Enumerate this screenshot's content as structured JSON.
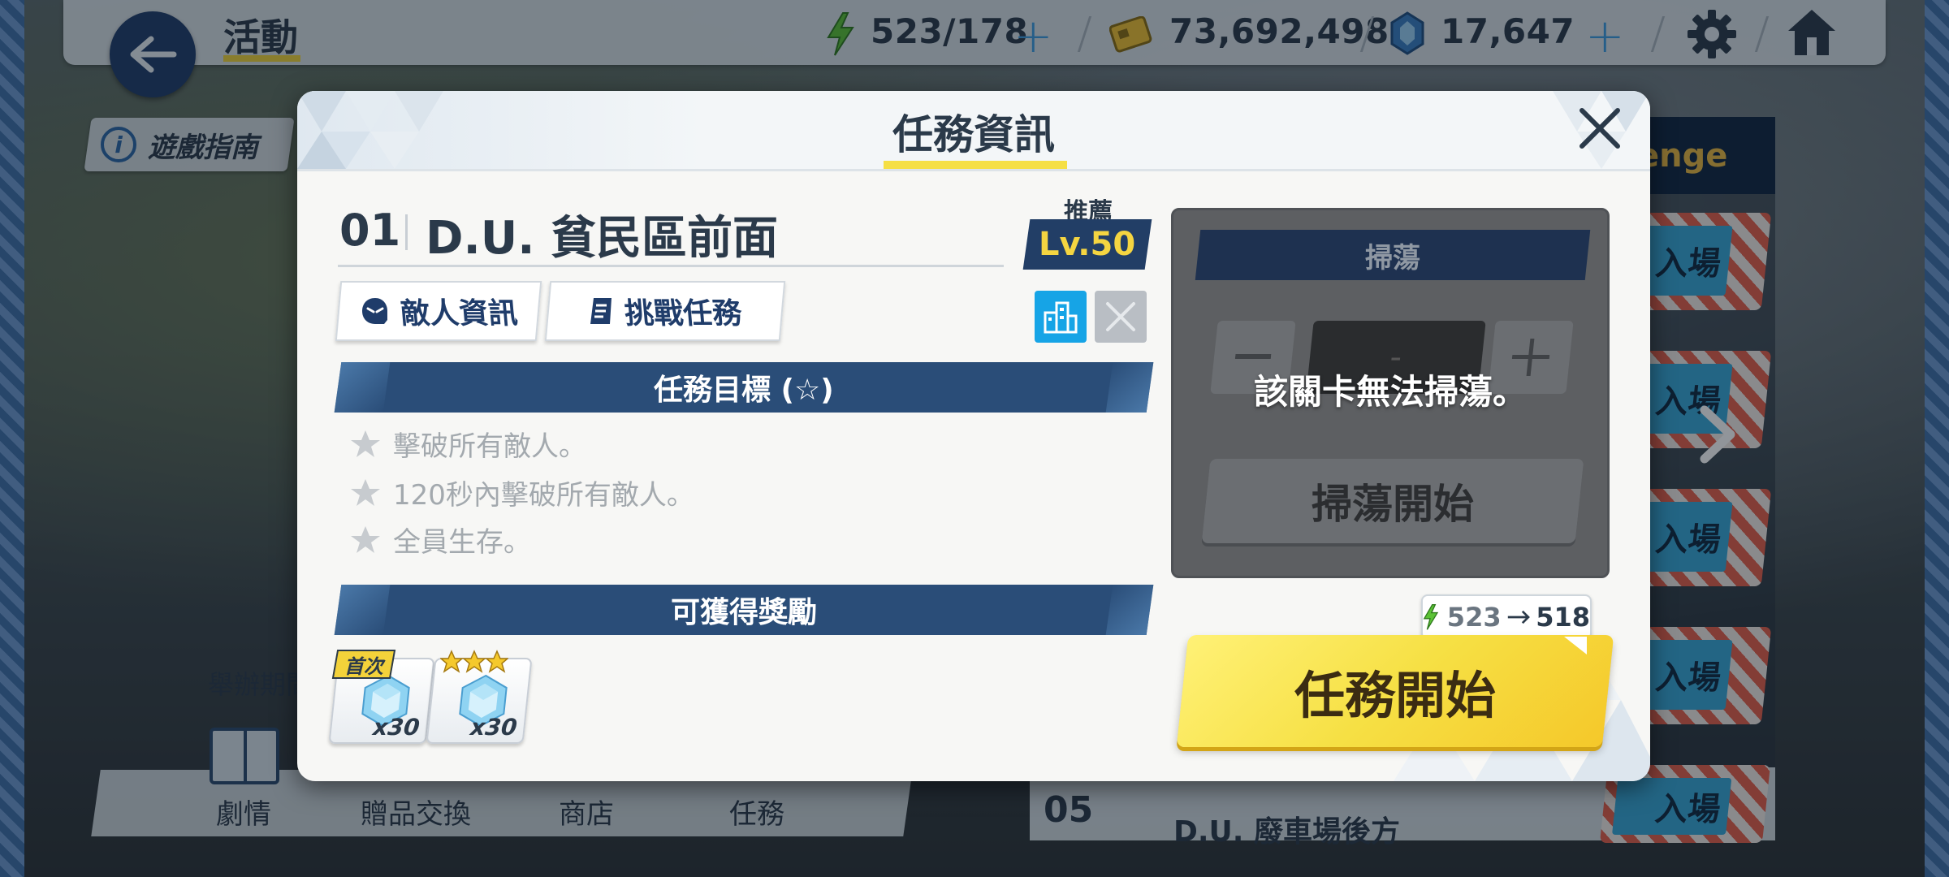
{
  "topbar": {
    "title": "活動",
    "ap": "523/178",
    "credits": "73,692,498",
    "gems": "17,647"
  },
  "left": {
    "guide_label": "遊戲指南",
    "period_label": "舉辦期間",
    "nav": [
      "劇情",
      "贈品交換",
      "商店",
      "任務"
    ]
  },
  "right_list": {
    "challenge_label": "enge",
    "enter_label": "入場",
    "row5_num": "05",
    "row5_name": "D.U. 廢車場後方"
  },
  "modal": {
    "title": "任務資訊",
    "stage_num": "01",
    "stage_name": "D.U. 貧民區前面",
    "recommend_label": "推薦",
    "recommend_level": "Lv.50",
    "enemy_info_label": "敵人資訊",
    "challenge_mission_label": "挑戰任務",
    "objectives_header": "任務目標 (☆)",
    "objectives": [
      "擊破所有敵人。",
      "120秒內擊破所有敵人。",
      "全員生存。"
    ],
    "rewards_header": "可獲得獎勵",
    "rewards": [
      {
        "tag": "首次",
        "qty": "x30"
      },
      {
        "tag": "",
        "qty": "x30",
        "stars": 3
      }
    ],
    "sweep": {
      "header": "掃蕩",
      "value": "-",
      "message": "該關卡無法掃蕩。",
      "start_label": "掃蕩開始"
    },
    "ap_cost": {
      "from": "523",
      "to": "518"
    },
    "start_label": "任務開始"
  },
  "colors": {
    "accent_yellow": "#f5df45",
    "navy": "#2a4d78",
    "blue": "#3b9be0"
  }
}
